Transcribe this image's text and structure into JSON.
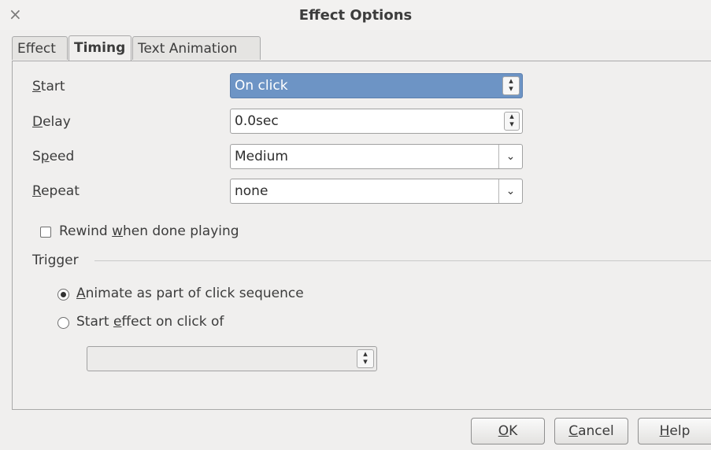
{
  "window": {
    "title": "Effect Options",
    "close_glyph": "×"
  },
  "tabs": [
    {
      "label": "Effect",
      "active": false
    },
    {
      "label": "Timing",
      "active": true
    },
    {
      "label": "Text Animation",
      "active": false
    }
  ],
  "timing": {
    "start": {
      "label": "Start",
      "mnemonic": "S",
      "rest": "tart",
      "value": "On click"
    },
    "delay": {
      "label": "Delay",
      "mnemonic": "D",
      "rest": "elay",
      "value": "0.0sec"
    },
    "speed": {
      "label": "Speed",
      "pre": "S",
      "mnemonic": "p",
      "rest": "eed",
      "value": "Medium"
    },
    "repeat": {
      "label": "Repeat",
      "mnemonic": "R",
      "rest": "epeat",
      "value": "none"
    },
    "rewind": {
      "pre": "Rewind ",
      "mnemonic": "w",
      "rest": "hen done playing",
      "checked": false
    }
  },
  "trigger": {
    "heading": "Trigger",
    "option1": {
      "mnemonic": "A",
      "rest": "nimate as part of click sequence",
      "selected": true
    },
    "option2": {
      "pre": "Start ",
      "mnemonic": "e",
      "rest": "ffect on click of",
      "selected": false
    },
    "shape_select_value": ""
  },
  "buttons": {
    "ok": {
      "mnemonic": "O",
      "rest": "K"
    },
    "cancel": {
      "mnemonic": "C",
      "rest": "ancel"
    },
    "help": {
      "mnemonic": "H",
      "rest": "elp"
    }
  },
  "colors": {
    "selection": "#6d94c5",
    "dialog_bg": "#f0efee"
  },
  "icons": {
    "spin": "spin-arrows-icon",
    "dropdown": "chevron-down-icon",
    "close": "close-icon"
  }
}
